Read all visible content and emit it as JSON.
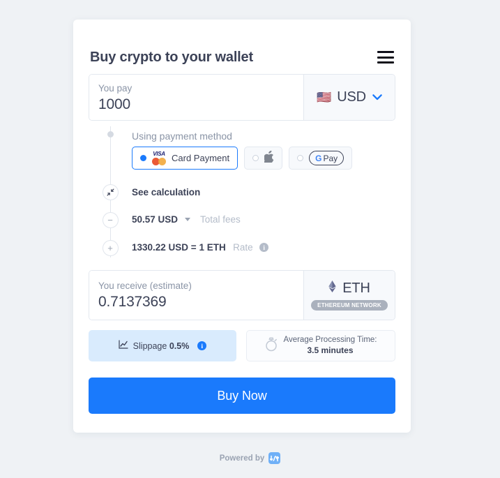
{
  "header": {
    "title": "Buy crypto to your wallet",
    "menu_icon": "hamburger-menu-icon"
  },
  "pay": {
    "label": "You pay",
    "value": "1000",
    "currency": "USD",
    "flag": "🇺🇸",
    "chevron_color": "#1a7afc"
  },
  "payment_method": {
    "title": "Using payment method",
    "options": [
      {
        "id": "card",
        "label": "Card Payment",
        "selected": true,
        "icon": "visa-mastercard-icon"
      },
      {
        "id": "apple-pay",
        "label": "",
        "selected": false,
        "icon": "apple-pay-icon",
        "glyph": ""
      },
      {
        "id": "google-pay",
        "label": "Pay",
        "selected": false,
        "icon": "google-pay-icon",
        "g": "G"
      }
    ]
  },
  "calculation": {
    "see_calculation": "See calculation",
    "fees_value": "50.57 USD",
    "fees_label": "Total fees",
    "rate_value": "1330.22 USD = 1 ETH",
    "rate_label": "Rate",
    "info_glyph": "i"
  },
  "receive": {
    "label": "You receive (estimate)",
    "value": "0.7137369",
    "coin": "ETH",
    "coin_icon": "♦",
    "network_badge": "ETHEREUM NETWORK"
  },
  "pills": {
    "slippage_label": "Slippage",
    "slippage_value": "0.5%",
    "time_label": "Average Processing Time:",
    "time_value": "3.5 minutes"
  },
  "cta": {
    "buy_label": "Buy Now"
  },
  "footer": {
    "powered_by": "Powered by",
    "brand_icon": "wave-arrow-logo-icon"
  },
  "colors": {
    "accent": "#1a7afc",
    "page_bg": "#eff2f5",
    "text": "#3c4257",
    "muted": "#8a94a6"
  }
}
